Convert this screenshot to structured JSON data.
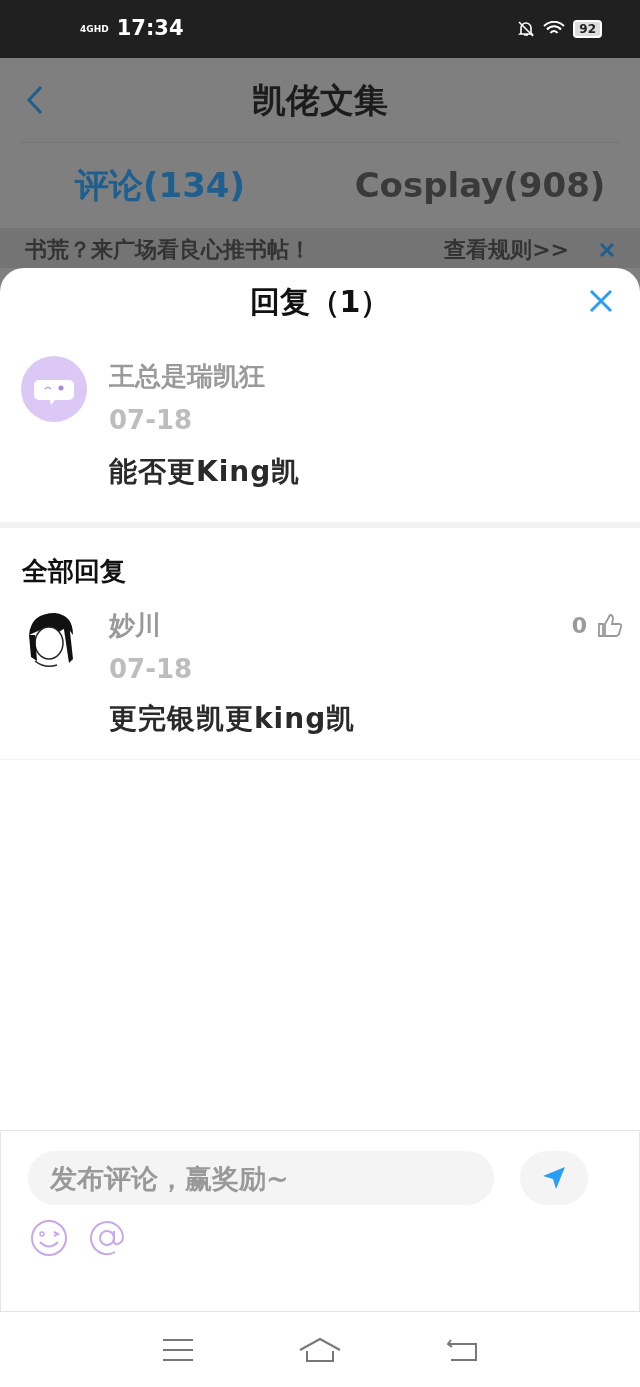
{
  "status_bar": {
    "network": "4GHD",
    "time": "17:34",
    "battery": "92"
  },
  "header": {
    "title": "凯佬文集"
  },
  "tabs": [
    {
      "label": "评论(134)",
      "selected": true
    },
    {
      "label": "Cosplay(908)",
      "selected": false
    }
  ],
  "banner": {
    "text": "书荒？来广场看良心推书帖！",
    "link": "查看规则>>"
  },
  "sheet": {
    "title": "回复（1）",
    "comment": {
      "author": "王总是瑞凯狂",
      "date": "07-18",
      "text": "能否更King凯"
    },
    "replies_heading": "全部回复",
    "replies": [
      {
        "author": "妙川",
        "date": "07-18",
        "text": "更完银凯更king凯",
        "likes": "0"
      }
    ],
    "input": {
      "placeholder": "发布评论，赢奖励~"
    }
  }
}
